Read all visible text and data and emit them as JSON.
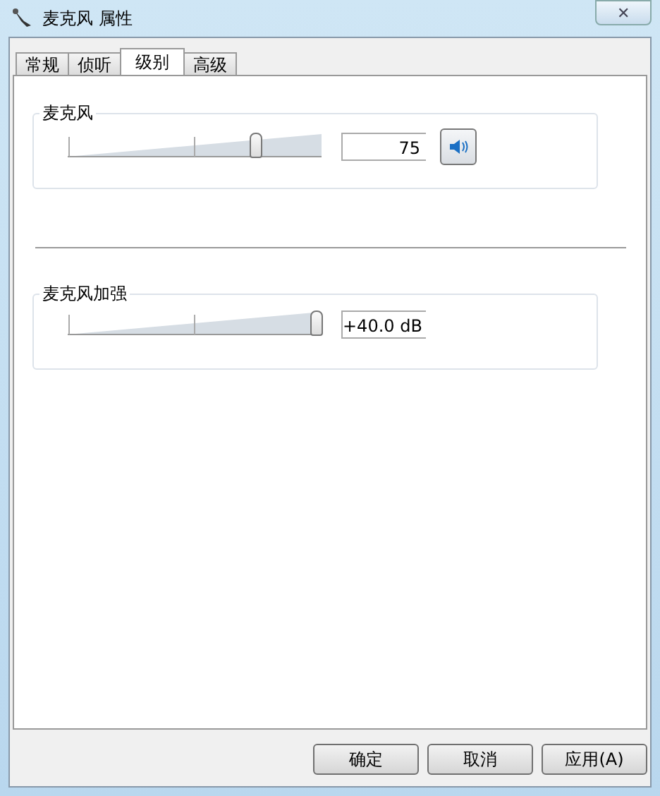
{
  "window": {
    "title": "麦克风 属性",
    "close": "✕"
  },
  "tabs": [
    {
      "label": "常规",
      "selected": false
    },
    {
      "label": "侦听",
      "selected": false
    },
    {
      "label": "级别",
      "selected": true
    },
    {
      "label": "高级",
      "selected": false
    }
  ],
  "groups": [
    {
      "title": "麦克风",
      "level": 0.75,
      "value": "75",
      "mute_button": true
    },
    {
      "title": "麦克风加强",
      "level": 1,
      "value": "+40.0 dB",
      "mute_button": false
    }
  ],
  "buttons": [
    "确定",
    "取消",
    "应用(A)"
  ]
}
